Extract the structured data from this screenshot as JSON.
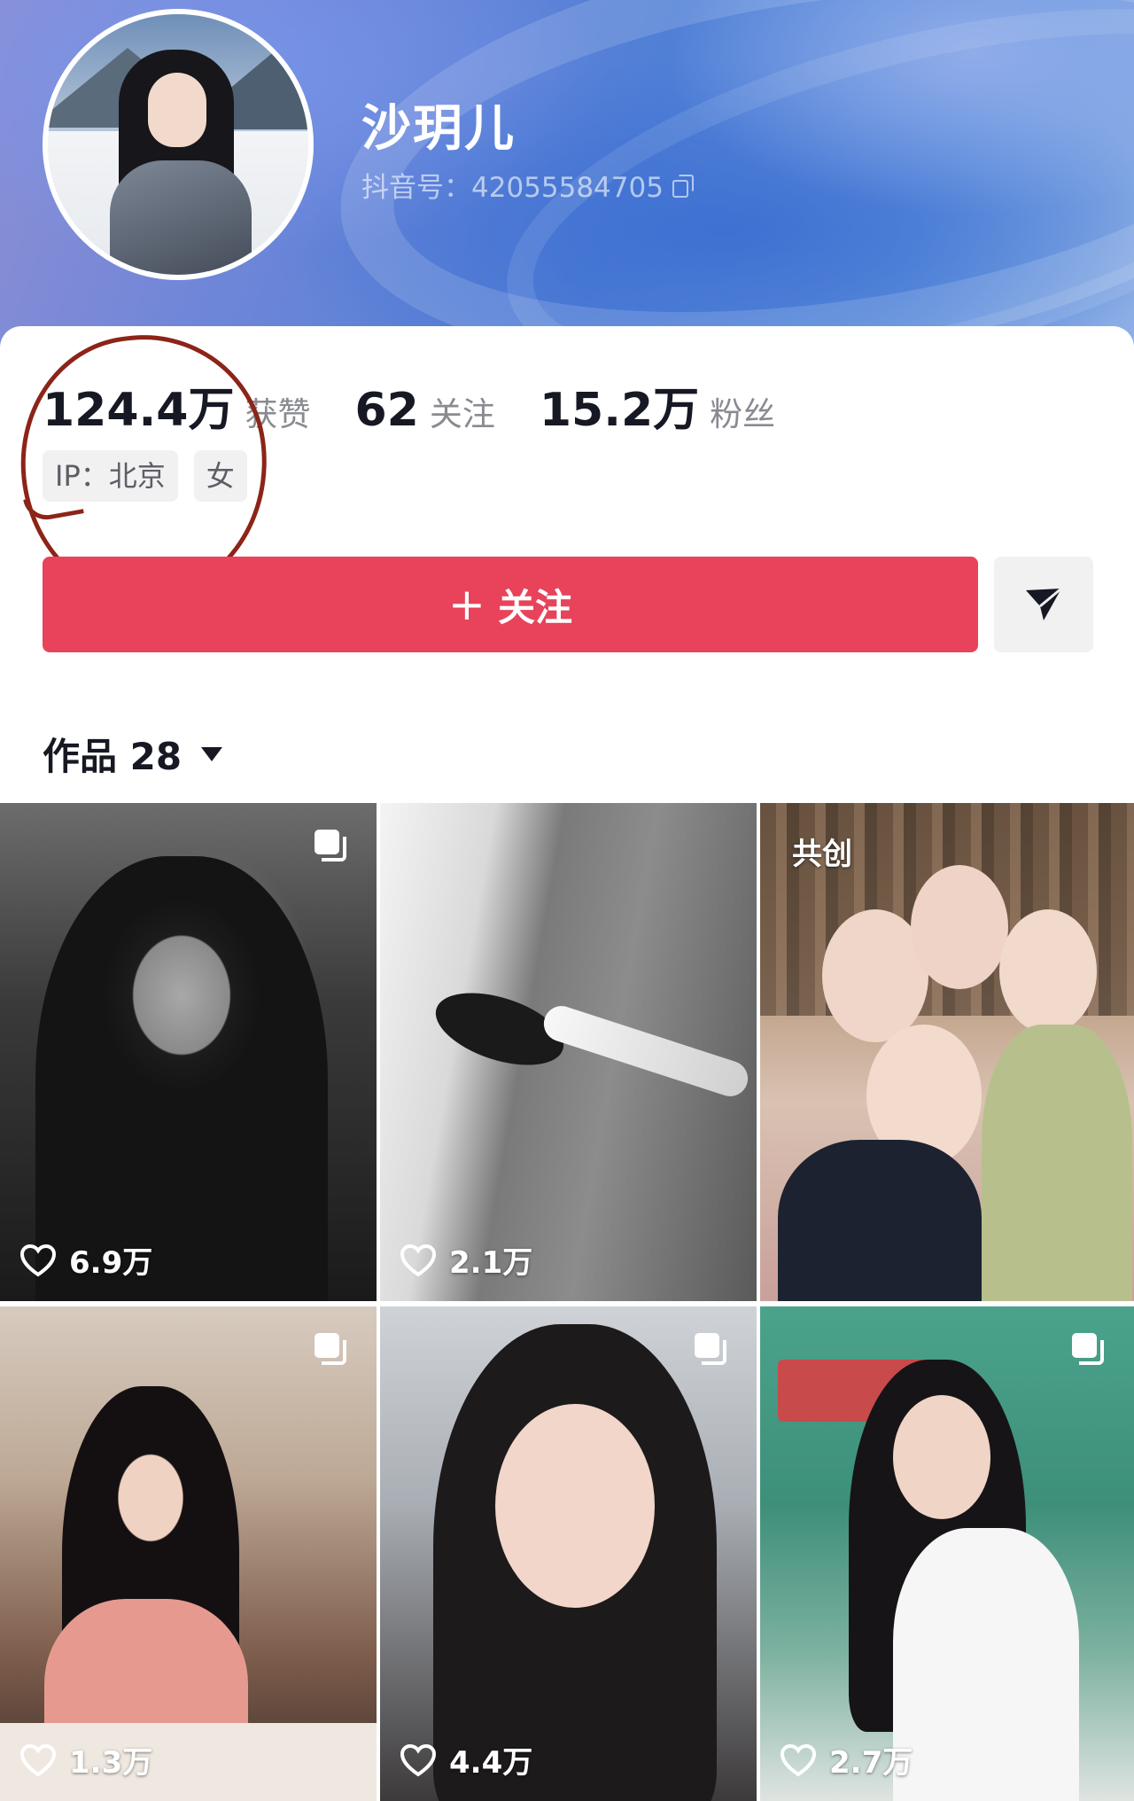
{
  "profile": {
    "name": "沙玥儿",
    "douyin_id": "抖音号：42055584705",
    "stats": [
      {
        "value": "124.4万",
        "label": "获赞"
      },
      {
        "value": "62",
        "label": "关注"
      },
      {
        "value": "15.2万",
        "label": "粉丝"
      }
    ],
    "tags": [
      "IP：北京",
      "女"
    ]
  },
  "actions": {
    "follow_label": "关注",
    "follow_color": "#e8435a"
  },
  "works_tab": {
    "label": "作品 28"
  },
  "grid": [
    {
      "likes": "6.9万",
      "multi": true,
      "collab": ""
    },
    {
      "likes": "2.1万",
      "multi": false,
      "collab": ""
    },
    {
      "likes": "",
      "multi": false,
      "collab": "共创"
    },
    {
      "likes": "1.3万",
      "multi": true,
      "collab": ""
    },
    {
      "likes": "4.4万",
      "multi": true,
      "collab": ""
    },
    {
      "likes": "2.7万",
      "multi": true,
      "collab": ""
    }
  ],
  "annotation": {
    "color": "#8c2418"
  }
}
